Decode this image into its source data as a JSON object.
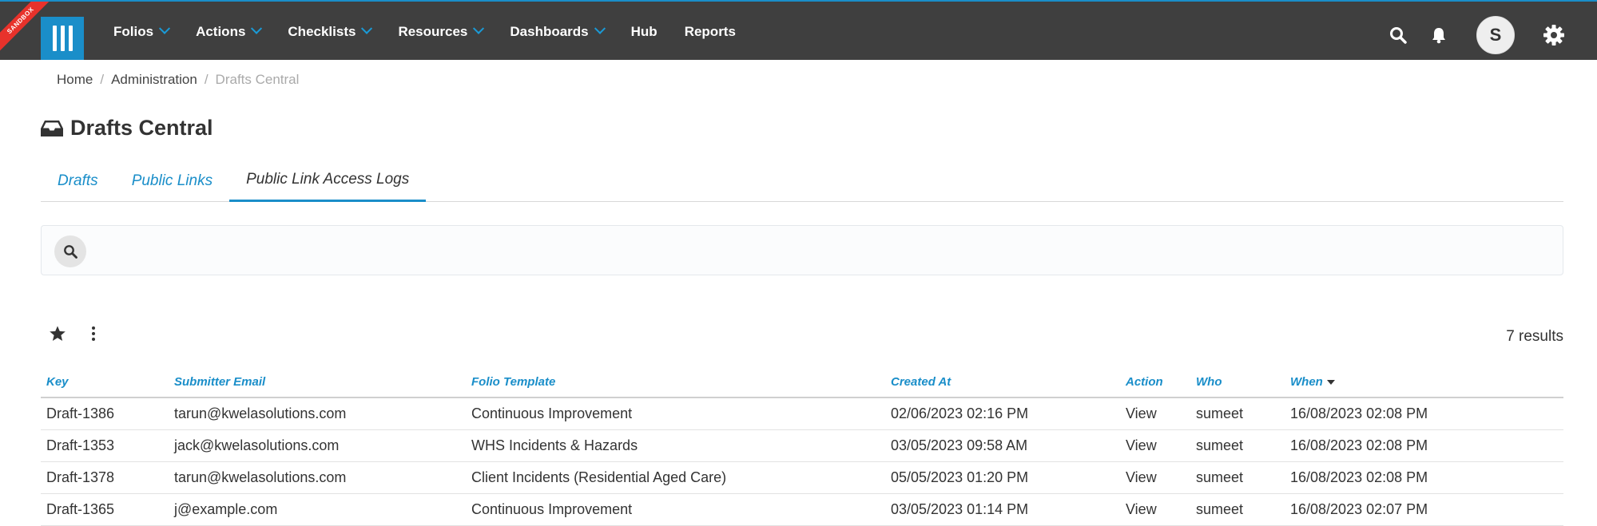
{
  "env_badge": "SANDBOX",
  "nav": {
    "items": [
      {
        "label": "Folios",
        "dropdown": true
      },
      {
        "label": "Actions",
        "dropdown": true
      },
      {
        "label": "Checklists",
        "dropdown": true
      },
      {
        "label": "Resources",
        "dropdown": true
      },
      {
        "label": "Dashboards",
        "dropdown": true
      },
      {
        "label": "Hub",
        "dropdown": false
      },
      {
        "label": "Reports",
        "dropdown": false
      }
    ],
    "avatar_initial": "S"
  },
  "breadcrumb": {
    "items": [
      "Home",
      "Administration"
    ],
    "current": "Drafts Central"
  },
  "page": {
    "title": "Drafts Central"
  },
  "tabs": [
    {
      "label": "Drafts",
      "active": false
    },
    {
      "label": "Public Links",
      "active": false
    },
    {
      "label": "Public Link Access Logs",
      "active": true
    }
  ],
  "results_text": "7 results",
  "table": {
    "columns": [
      "Key",
      "Submitter Email",
      "Folio Template",
      "Created At",
      "Action",
      "Who",
      "When"
    ],
    "rows": [
      [
        "Draft-1386",
        "tarun@kwelasolutions.com",
        "Continuous Improvement",
        "02/06/2023 02:16 PM",
        "View",
        "sumeet",
        "16/08/2023 02:08 PM"
      ],
      [
        "Draft-1353",
        "jack@kwelasolutions.com",
        "WHS Incidents & Hazards",
        "03/05/2023 09:58 AM",
        "View",
        "sumeet",
        "16/08/2023 02:08 PM"
      ],
      [
        "Draft-1378",
        "tarun@kwelasolutions.com",
        "Client Incidents (Residential Aged Care)",
        "05/05/2023 01:20 PM",
        "View",
        "sumeet",
        "16/08/2023 02:08 PM"
      ],
      [
        "Draft-1365",
        "j@example.com",
        "Continuous Improvement",
        "03/05/2023 01:14 PM",
        "View",
        "sumeet",
        "16/08/2023 02:07 PM"
      ]
    ]
  },
  "colors": {
    "topbar": "#3f3f3f",
    "accent": "#1a8ec9",
    "ribbon": "#e8322b"
  }
}
